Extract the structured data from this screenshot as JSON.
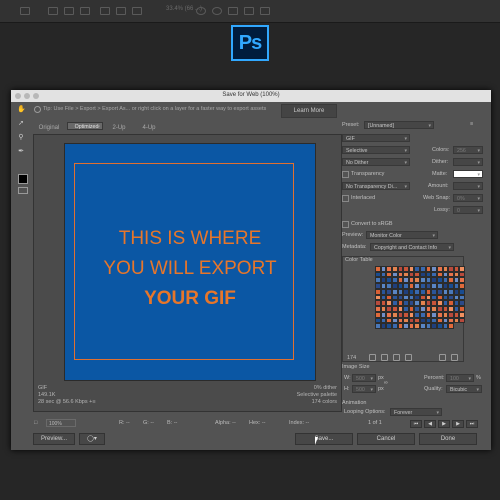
{
  "app": {
    "logo_text": "Ps",
    "zoom_readout": "33.4% (66 ...)"
  },
  "window": {
    "title": "Save for Web (100%)",
    "tip": "Tip: Use File > Export > Export As... or right click on a layer for a faster way to export assets",
    "learn_more": "Learn More"
  },
  "tabs": [
    "Original",
    "Optimized",
    "2-Up",
    "4-Up"
  ],
  "preview": {
    "line1": "THIS IS WHERE",
    "line2": "YOU WILL EXPORT",
    "line3": "YOUR GIF",
    "bg_color": "#0b57a4",
    "text_color": "#e7762a"
  },
  "image_info": {
    "format": "GIF",
    "size": "149.1K",
    "speed": "28 sec @ 56.6 Kbps",
    "speed_suffix": "+≡",
    "dither": "0% dither",
    "palette": "Selective palette",
    "colors": "174 colors"
  },
  "statusbar": {
    "zoom": "100%",
    "r": "R: --",
    "g": "G: --",
    "b": "B: --",
    "alpha": "Alpha: --",
    "hex": "Hex: --",
    "index": "Index: --"
  },
  "buttons": {
    "preview": "Preview...",
    "save": "Save...",
    "cancel": "Cancel",
    "done": "Done"
  },
  "settings": {
    "preset_label": "Preset:",
    "preset_value": "[Unnamed]",
    "format": "GIF",
    "reduction": "Selective",
    "colors_label": "Colors:",
    "colors_value": "256",
    "dither_algo": "No Dither",
    "dither_label": "Dither:",
    "transparency": "Transparency",
    "matte_label": "Matte:",
    "trans_dither": "No Transparency Di...",
    "amount_label": "Amount:",
    "interlaced": "Interlaced",
    "websnap_label": "Web Snap:",
    "websnap_value": "0%",
    "lossy_label": "Lossy:",
    "lossy_value": "0",
    "convert_srgb": "Convert to sRGB",
    "preview_label": "Preview:",
    "preview_value": "Monitor Color",
    "metadata_label": "Metadata:",
    "metadata_value": "Copyright and Contact Info",
    "color_table_label": "Color Table",
    "color_count": "174",
    "image_size_label": "Image Size",
    "w_label": "W:",
    "w_value": "500",
    "h_label": "H:",
    "h_value": "500",
    "px": "px",
    "percent_label": "Percent:",
    "percent_value": "100",
    "pct": "%",
    "quality_label": "Quality:",
    "quality_value": "Bicubic",
    "animation_label": "Animation",
    "looping_label": "Looping Options:",
    "looping_value": "Forever",
    "frame_counter": "1 of 1"
  },
  "color_table_colors": [
    "#e06a3a",
    "#2f5fa6",
    "#1a4c90",
    "#c9553a",
    "#4a78b8",
    "#e3844f",
    "#2c4a8a",
    "#6f8fc8",
    "#d85f34",
    "#3a6ab0",
    "#f09060",
    "#1f3f7c",
    "#b84a3c",
    "#5a86c4",
    "#e8734a",
    "#2a5599"
  ]
}
